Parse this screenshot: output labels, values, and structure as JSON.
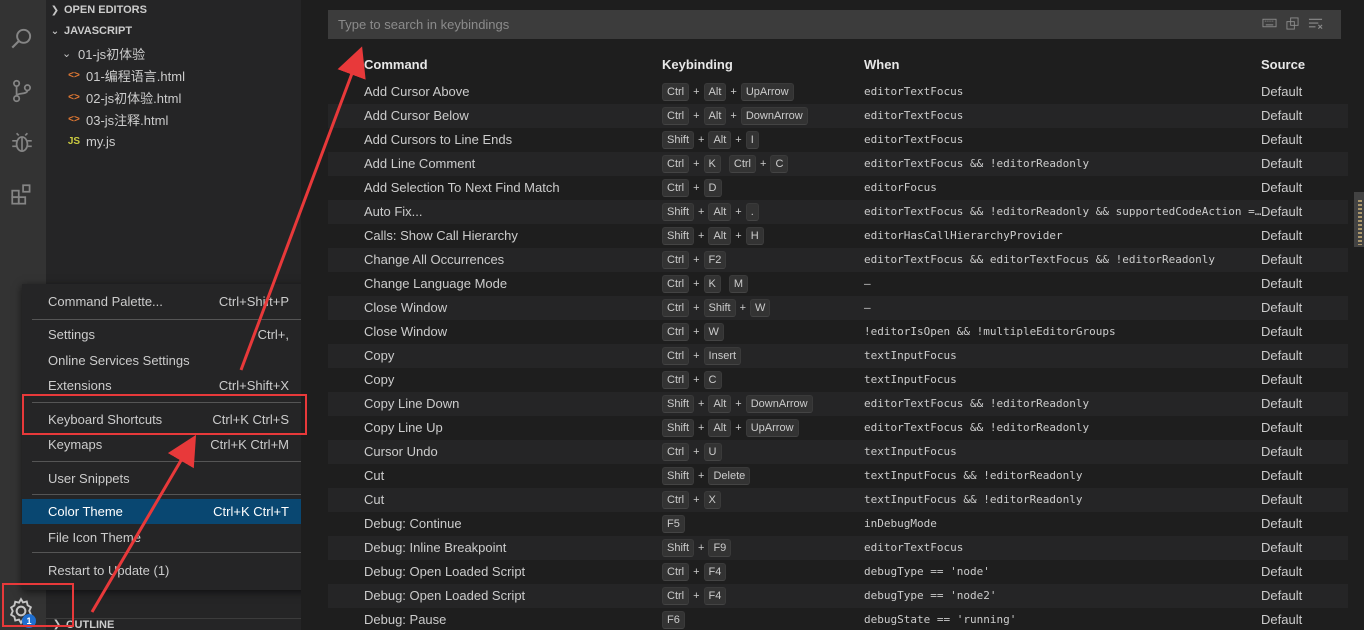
{
  "sidebar": {
    "open_editors_label": "OPEN EDITORS",
    "javascript_label": "JAVASCRIPT",
    "folder": "01-js初体验",
    "files": [
      {
        "icon": "<>",
        "name": "01-编程语言.html"
      },
      {
        "icon": "<>",
        "name": "02-js初体验.html"
      },
      {
        "icon": "<>",
        "name": "03-js注释.html"
      },
      {
        "icon": "JS",
        "name": "my.js"
      }
    ],
    "outline_label": "OUTLINE"
  },
  "activity": {
    "icons": [
      "search-icon",
      "source-control-icon",
      "debug-icon",
      "extensions-icon"
    ],
    "gear_badge": "1"
  },
  "menu": {
    "items": [
      {
        "label": "Command Palette...",
        "shortcut": "Ctrl+Shift+P"
      },
      {
        "label": "Settings",
        "shortcut": "Ctrl+,"
      },
      {
        "label": "Online Services Settings",
        "shortcut": ""
      },
      {
        "label": "Extensions",
        "shortcut": "Ctrl+Shift+X"
      },
      {
        "label": "Keyboard Shortcuts",
        "shortcut": "Ctrl+K Ctrl+S"
      },
      {
        "label": "Keymaps",
        "shortcut": "Ctrl+K Ctrl+M"
      },
      {
        "label": "User Snippets",
        "shortcut": ""
      },
      {
        "label": "Color Theme",
        "shortcut": "Ctrl+K Ctrl+T"
      },
      {
        "label": "File Icon Theme",
        "shortcut": ""
      },
      {
        "label": "Restart to Update (1)",
        "shortcut": ""
      }
    ],
    "selected": "Color Theme"
  },
  "keybindings": {
    "search_placeholder": "Type to search in keybindings",
    "columns": {
      "command": "Command",
      "keybinding": "Keybinding",
      "when": "When",
      "source": "Source"
    },
    "rows": [
      {
        "command": "Add Cursor Above",
        "keys": [
          [
            "Ctrl",
            "Alt",
            "UpArrow"
          ]
        ],
        "when": "editorTextFocus",
        "source": "Default"
      },
      {
        "command": "Add Cursor Below",
        "keys": [
          [
            "Ctrl",
            "Alt",
            "DownArrow"
          ]
        ],
        "when": "editorTextFocus",
        "source": "Default"
      },
      {
        "command": "Add Cursors to Line Ends",
        "keys": [
          [
            "Shift",
            "Alt",
            "I"
          ]
        ],
        "when": "editorTextFocus",
        "source": "Default"
      },
      {
        "command": "Add Line Comment",
        "keys": [
          [
            "Ctrl",
            "K"
          ],
          [
            "Ctrl",
            "C"
          ]
        ],
        "when": "editorTextFocus && !editorReadonly",
        "source": "Default"
      },
      {
        "command": "Add Selection To Next Find Match",
        "keys": [
          [
            "Ctrl",
            "D"
          ]
        ],
        "when": "editorFocus",
        "source": "Default"
      },
      {
        "command": "Auto Fix...",
        "keys": [
          [
            "Shift",
            "Alt",
            "."
          ]
        ],
        "when": "editorTextFocus && !editorReadonly && supportedCodeAction =…",
        "source": "Default"
      },
      {
        "command": "Calls: Show Call Hierarchy",
        "keys": [
          [
            "Shift",
            "Alt",
            "H"
          ]
        ],
        "when": "editorHasCallHierarchyProvider",
        "source": "Default"
      },
      {
        "command": "Change All Occurrences",
        "keys": [
          [
            "Ctrl",
            "F2"
          ]
        ],
        "when": "editorTextFocus && editorTextFocus && !editorReadonly",
        "source": "Default"
      },
      {
        "command": "Change Language Mode",
        "keys": [
          [
            "Ctrl",
            "K"
          ],
          [
            "M"
          ]
        ],
        "when": "—",
        "source": "Default"
      },
      {
        "command": "Close Window",
        "keys": [
          [
            "Ctrl",
            "Shift",
            "W"
          ]
        ],
        "when": "—",
        "source": "Default"
      },
      {
        "command": "Close Window",
        "keys": [
          [
            "Ctrl",
            "W"
          ]
        ],
        "when": "!editorIsOpen && !multipleEditorGroups",
        "source": "Default"
      },
      {
        "command": "Copy",
        "keys": [
          [
            "Ctrl",
            "Insert"
          ]
        ],
        "when": "textInputFocus",
        "source": "Default"
      },
      {
        "command": "Copy",
        "keys": [
          [
            "Ctrl",
            "C"
          ]
        ],
        "when": "textInputFocus",
        "source": "Default"
      },
      {
        "command": "Copy Line Down",
        "keys": [
          [
            "Shift",
            "Alt",
            "DownArrow"
          ]
        ],
        "when": "editorTextFocus && !editorReadonly",
        "source": "Default"
      },
      {
        "command": "Copy Line Up",
        "keys": [
          [
            "Shift",
            "Alt",
            "UpArrow"
          ]
        ],
        "when": "editorTextFocus && !editorReadonly",
        "source": "Default"
      },
      {
        "command": "Cursor Undo",
        "keys": [
          [
            "Ctrl",
            "U"
          ]
        ],
        "when": "textInputFocus",
        "source": "Default"
      },
      {
        "command": "Cut",
        "keys": [
          [
            "Shift",
            "Delete"
          ]
        ],
        "when": "textInputFocus && !editorReadonly",
        "source": "Default"
      },
      {
        "command": "Cut",
        "keys": [
          [
            "Ctrl",
            "X"
          ]
        ],
        "when": "textInputFocus && !editorReadonly",
        "source": "Default"
      },
      {
        "command": "Debug: Continue",
        "keys": [
          [
            "F5"
          ]
        ],
        "when": "inDebugMode",
        "source": "Default"
      },
      {
        "command": "Debug: Inline Breakpoint",
        "keys": [
          [
            "Shift",
            "F9"
          ]
        ],
        "when": "editorTextFocus",
        "source": "Default"
      },
      {
        "command": "Debug: Open Loaded Script",
        "keys": [
          [
            "Ctrl",
            "F4"
          ]
        ],
        "when": "debugType == 'node'",
        "source": "Default"
      },
      {
        "command": "Debug: Open Loaded Script",
        "keys": [
          [
            "Ctrl",
            "F4"
          ]
        ],
        "when": "debugType == 'node2'",
        "source": "Default"
      },
      {
        "command": "Debug: Pause",
        "keys": [
          [
            "F6"
          ]
        ],
        "when": "debugState == 'running'",
        "source": "Default"
      }
    ]
  },
  "colors": {
    "annotation": "#e8393a",
    "selection": "#094771"
  }
}
